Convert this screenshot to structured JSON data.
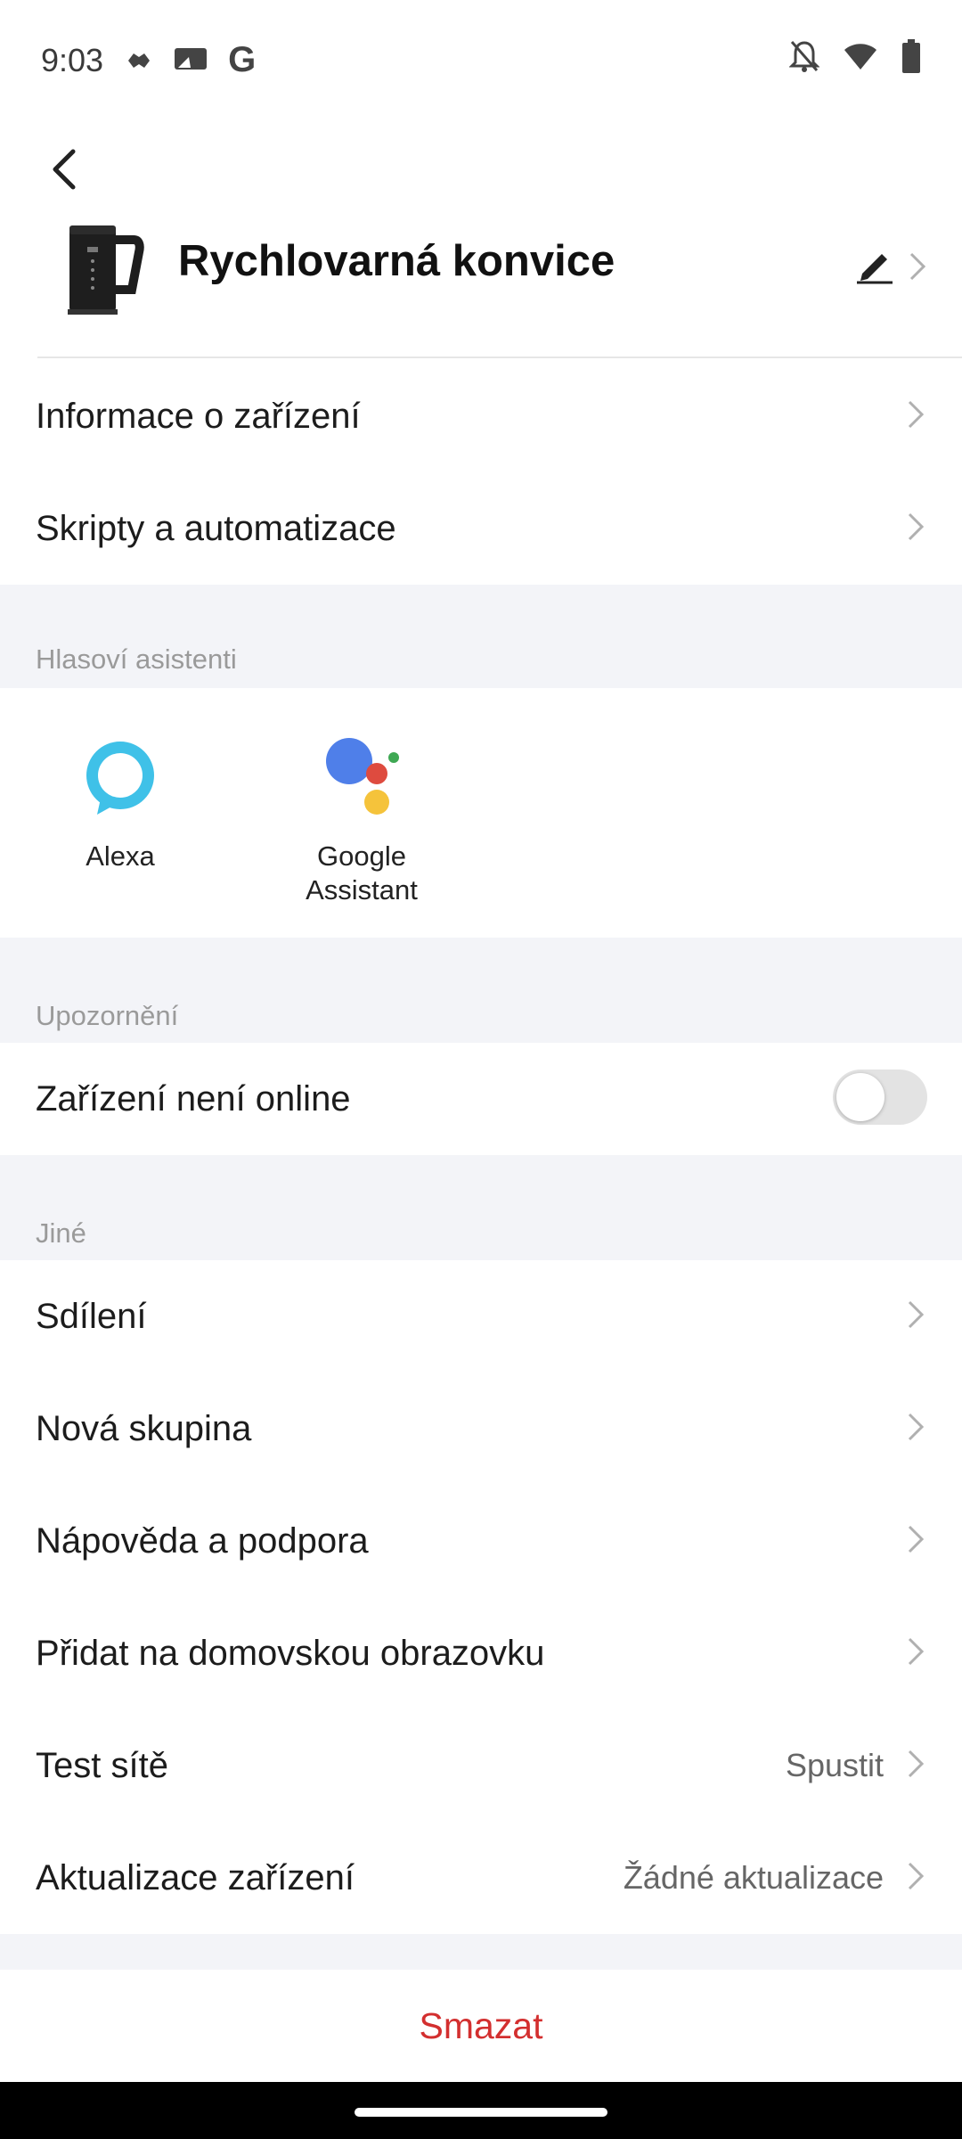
{
  "status_bar": {
    "time": "9:03",
    "left_icons": [
      "game-controller-icon",
      "screencast-icon",
      "google-g-icon"
    ],
    "right_icons": [
      "bell-off-icon",
      "wifi-icon",
      "battery-icon"
    ],
    "google_letter": "G"
  },
  "header": {
    "back_icon": "chevron-left-icon",
    "device_name": "Rychlovarná konvice",
    "edit_icon": "pencil-icon"
  },
  "menu_top": [
    {
      "label": "Informace o zařízení"
    },
    {
      "label": "Skripty a automatizace"
    }
  ],
  "voice_assistants": {
    "title": "Hlasoví asistenti",
    "items": [
      {
        "name": "Alexa",
        "icon": "alexa-icon"
      },
      {
        "name_line1": "Google",
        "name_line2": "Assistant",
        "icon": "google-assistant-icon"
      }
    ]
  },
  "notifications": {
    "title": "Upozornění",
    "offline_label": "Zařízení není online",
    "offline_enabled": false
  },
  "other": {
    "title": "Jiné",
    "items": [
      {
        "label": "Sdílení",
        "value": ""
      },
      {
        "label": "Nová skupina",
        "value": ""
      },
      {
        "label": "Nápověda a podpora",
        "value": ""
      },
      {
        "label": "Přidat na domovskou obrazovku",
        "value": ""
      },
      {
        "label": "Test sítě",
        "value": "Spustit"
      },
      {
        "label": "Aktualizace zařízení",
        "value": "Žádné aktualizace"
      }
    ]
  },
  "delete_label": "Smazat",
  "colors": {
    "accent_red": "#d32f2f",
    "section_bg": "#f3f4f8",
    "alexa_blue": "#3fc1e8",
    "google_blue": "#4f7fe9",
    "google_red": "#de4b3f",
    "google_yellow": "#f5c33b",
    "google_green": "#3ea853"
  }
}
